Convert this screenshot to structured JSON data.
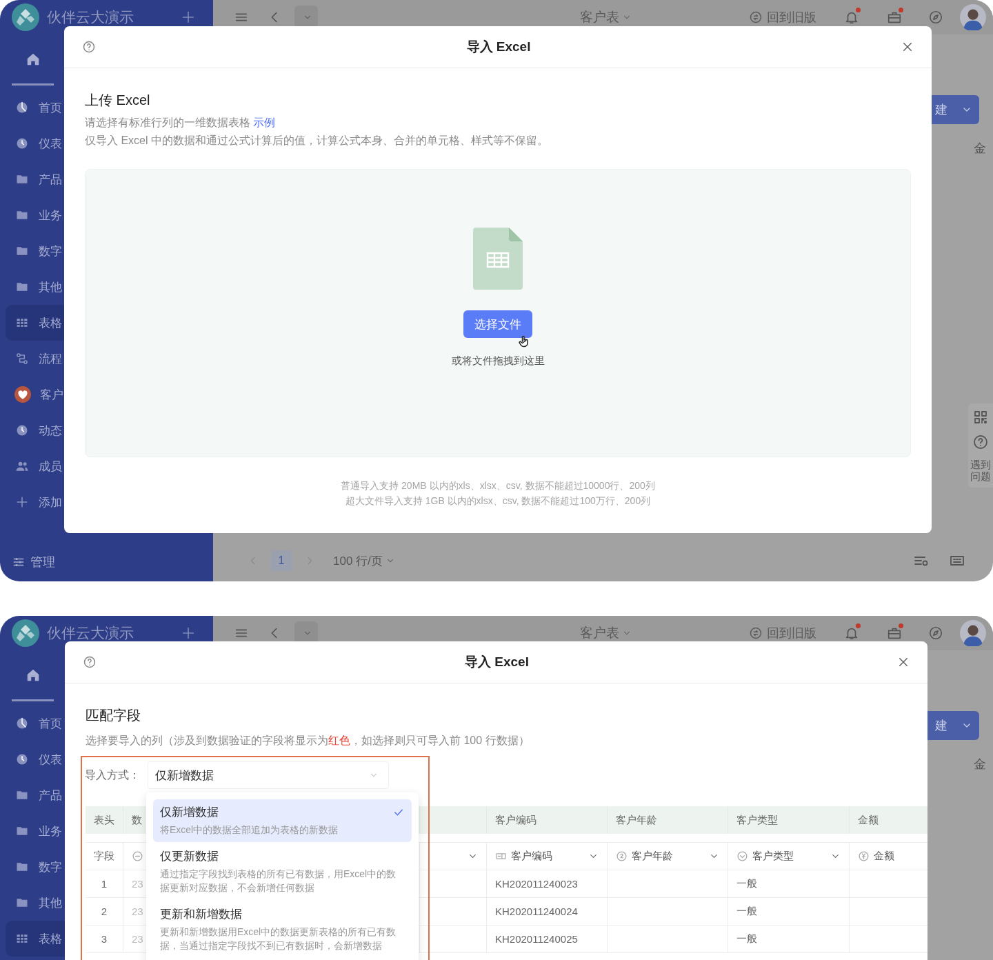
{
  "screens": [
    {
      "kind": "upload",
      "app_name": "伙伴云大演示",
      "home_tab_selected": true,
      "sidebar": [
        {
          "kind": "pie",
          "label": "首页",
          "selected": false
        },
        {
          "kind": "clock",
          "label": "仪表",
          "selected": false
        },
        {
          "kind": "folder",
          "label": "产品",
          "selected": false
        },
        {
          "kind": "folder",
          "label": "业务",
          "selected": false
        },
        {
          "kind": "folder",
          "label": "数字",
          "selected": false
        },
        {
          "kind": "folder",
          "label": "其他",
          "selected": false
        },
        {
          "kind": "grid",
          "label": "表格",
          "selected": true
        },
        {
          "kind": "flow",
          "label": "流程",
          "selected": false
        },
        {
          "kind": "heart",
          "label": "客户",
          "selected": false
        },
        {
          "kind": "clock",
          "label": "动态",
          "selected": false
        },
        {
          "kind": "people",
          "label": "成员",
          "selected": false
        },
        {
          "kind": "add",
          "label": "添加",
          "selected": false
        }
      ],
      "sidebar_footer": "管理",
      "topbar": {
        "table_name": "客户表",
        "old_version": "回到旧版",
        "bell_badge": true,
        "briefcase_badge": true
      },
      "create_button": "建",
      "column_header": "金",
      "side_help": "遇到问题",
      "pager": {
        "pages": [
          {
            "label": "1",
            "selected": true
          }
        ],
        "page_size": "100 行/页"
      },
      "modal": {
        "title": "导入 Excel",
        "heading": "上传 Excel",
        "intro": "请选择有标准行列的一维数据表格",
        "example_link": "示例",
        "note": "仅导入 Excel 中的数据和通过公式计算后的值，计算公式本身、合并的单元格、样式等不保留。",
        "choose_button": "选择文件",
        "drop_hint": "或将文件拖拽到这里",
        "limits": [
          "普通导入支持 20MB 以内的xls、xlsx、csv, 数据不能超过10000行、200列",
          "超大文件导入支持 1GB 以内的xlsx、csv, 数据不能超过100万行、200列"
        ]
      }
    },
    {
      "kind": "match",
      "app_name": "伙伴云大演示",
      "home_tab_selected": true,
      "sidebar": [
        {
          "kind": "pie",
          "label": "首页",
          "selected": false
        },
        {
          "kind": "clock",
          "label": "仪表",
          "selected": false
        },
        {
          "kind": "folder",
          "label": "产品",
          "selected": false
        },
        {
          "kind": "folder",
          "label": "业务",
          "selected": false
        },
        {
          "kind": "folder",
          "label": "数字",
          "selected": false
        },
        {
          "kind": "folder",
          "label": "其他",
          "selected": false
        },
        {
          "kind": "grid",
          "label": "表格",
          "selected": true
        }
      ],
      "topbar": {
        "table_name": "客户表",
        "old_version": "回到旧版",
        "bell_badge": true,
        "briefcase_badge": true
      },
      "create_button": "建",
      "column_header": "金",
      "modal": {
        "title": "导入 Excel",
        "heading": "匹配字段",
        "description": [
          {
            "kind": "normal",
            "text": "选择要导入的列（涉及到数据验证的字段将显示为"
          },
          {
            "kind": "warning",
            "text": "红色"
          },
          {
            "kind": "normal",
            "text": "，如选择则只可导入前 100 行数据）"
          }
        ],
        "import_mode": {
          "label": "导入方式：",
          "value": "仅新增数据",
          "options": [
            {
              "title": "仅新增数据",
              "description": "将Excel中的数据全部追加为表格的新数据",
              "selected": true
            },
            {
              "title": "仅更新数据",
              "description": "通过指定字段找到表格的所有已有数据，用Excel中的数据更新对应数据，不会新增任何数据",
              "selected": false
            },
            {
              "title": "更新和新增数据",
              "description": "更新和新增数据用Excel中的数据更新表格的所有已有数据，当通过指定字段找不到已有数据时，会新增数据",
              "selected": false
            }
          ]
        },
        "table": {
          "columns": [
            {
              "kind": "label",
              "header": "表头",
              "field": "字段"
            },
            {
              "kind": "minus",
              "header": "数"
            },
            {
              "kind": "plain",
              "dropdown": true
            },
            {
              "kind": "text",
              "header": "客户编码",
              "field": "客户编码",
              "dropdown": true
            },
            {
              "kind": "number",
              "header": "客户年龄",
              "field": "客户年龄",
              "dropdown": true
            },
            {
              "kind": "option",
              "header": "客户类型",
              "field": "客户类型",
              "dropdown": true
            },
            {
              "kind": "money",
              "header": "金额",
              "field": "金额",
              "dropdown": false
            }
          ],
          "rows": [
            {
              "cells": [
                "1",
                "23",
                null,
                "KH202011240023",
                null,
                "一般",
                null
              ]
            },
            {
              "cells": [
                "2",
                "23",
                null,
                "KH202011240024",
                null,
                "一般",
                null
              ]
            },
            {
              "cells": [
                "3",
                "23",
                null,
                "KH202011240025",
                null,
                "一般",
                null
              ]
            }
          ]
        }
      }
    }
  ]
}
